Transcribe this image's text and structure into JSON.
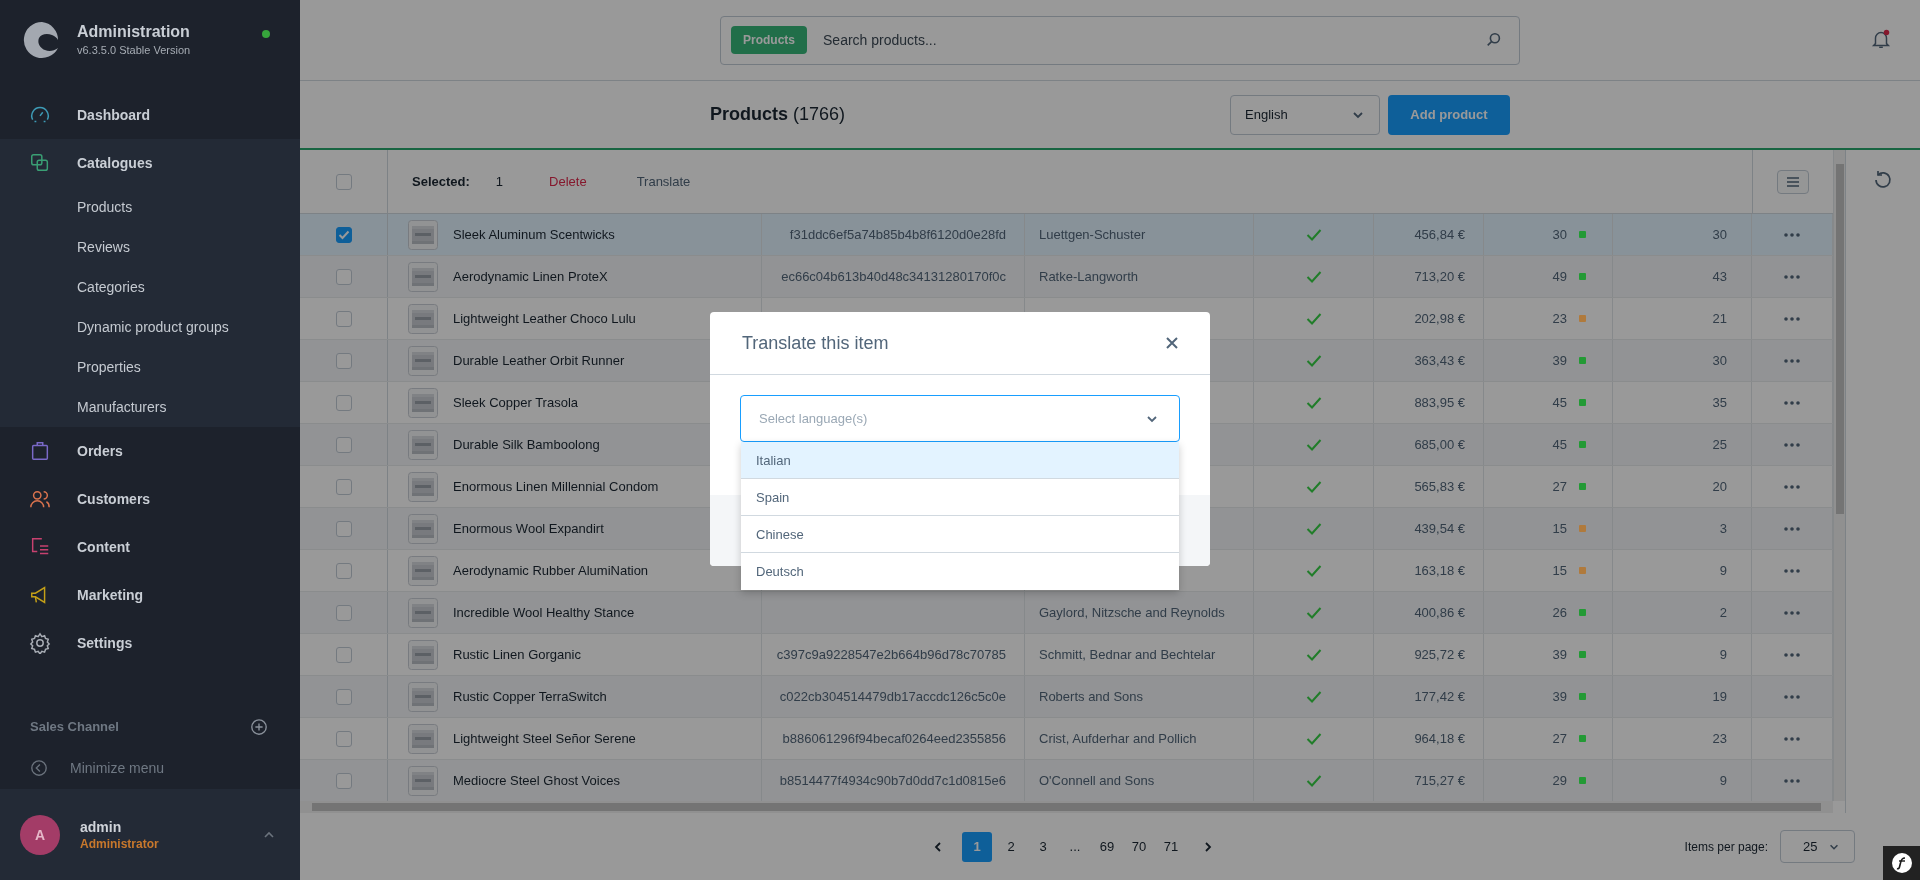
{
  "sidebar": {
    "title": "Administration",
    "version": "v6.3.5.0 Stable Version",
    "online": true,
    "items": [
      {
        "label": "Dashboard",
        "color": "#3e9bb6"
      },
      {
        "label": "Catalogues",
        "color": "#3a9f74",
        "children": [
          {
            "label": "Products"
          },
          {
            "label": "Reviews"
          },
          {
            "label": "Categories"
          },
          {
            "label": "Dynamic product groups"
          },
          {
            "label": "Properties"
          },
          {
            "label": "Manufacturers"
          }
        ]
      },
      {
        "label": "Orders",
        "color": "#7a69c8"
      },
      {
        "label": "Customers",
        "color": "#d9734e"
      },
      {
        "label": "Content",
        "color": "#c8416f"
      },
      {
        "label": "Marketing",
        "color": "#c4a017"
      },
      {
        "label": "Settings",
        "color": "#a8adb5"
      }
    ],
    "sales_channel": "Sales Channel",
    "minimize": "Minimize menu",
    "user": {
      "initial": "A",
      "name": "admin",
      "role": "Administrator"
    }
  },
  "header": {
    "search": {
      "scope": "Products",
      "placeholder": "Search products..."
    },
    "unread_notifications": true
  },
  "title_bar": {
    "title": "**Products** (1766)",
    "language": "English",
    "add_button": "Add product"
  },
  "table": {
    "bulk": {
      "all_selected": false,
      "label": "Selected:",
      "count": "1",
      "actions": [
        {
          "label": "Delete",
          "kind": "danger"
        },
        {
          "label": "Translate",
          "kind": "default"
        }
      ]
    },
    "rows": [
      {
        "selected": true,
        "name": "Sleek Aluminum Scentwicks",
        "number": "f31ddc6ef5a74b85b4b8f6120d0e28fd",
        "manufacturer": "Luettgen-Schuster",
        "active": true,
        "price": "456,84 €",
        "stock": "30",
        "color": "#239a35",
        "available": "30"
      },
      {
        "selected": false,
        "name": "Aerodynamic Linen ProteX",
        "number": "ec66c04b613b40d48c34131280170f0c",
        "manufacturer": "Ratke-Langworth",
        "active": true,
        "price": "713,20 €",
        "stock": "49",
        "color": "#239a35",
        "available": "43"
      },
      {
        "selected": false,
        "name": "Lightweight Leather Choco Lulu",
        "active": true,
        "price": "202,98 €",
        "stock": "23",
        "color": "#b07a3c",
        "available": "21"
      },
      {
        "selected": false,
        "name": "Durable Leather Orbit Runner",
        "active": true,
        "price": "363,43 €",
        "stock": "39",
        "color": "#239a35",
        "available": "30"
      },
      {
        "selected": false,
        "name": "Sleek Copper Trasola",
        "active": true,
        "price": "883,95 €",
        "stock": "45",
        "color": "#239a35",
        "available": "35"
      },
      {
        "selected": false,
        "name": "Durable Silk Bamboolong",
        "active": true,
        "price": "685,00 €",
        "stock": "45",
        "color": "#239a35",
        "available": "25"
      },
      {
        "selected": false,
        "name": "Enormous Linen Millennial Condom",
        "active": true,
        "price": "565,83 €",
        "stock": "27",
        "color": "#239a35",
        "available": "20"
      },
      {
        "selected": false,
        "name": "Enormous Wool Expandirt",
        "active": true,
        "price": "439,54 €",
        "stock": "15",
        "color": "#b07a3c",
        "available": "3"
      },
      {
        "selected": false,
        "name": "Aerodynamic Rubber AlumiNation",
        "active": true,
        "price": "163,18 €",
        "stock": "15",
        "color": "#b07a3c",
        "available": "9"
      },
      {
        "selected": false,
        "name": "Incredible Wool Healthy Stance",
        "manufacturer": "Gaylord, Nitzsche and Reynolds",
        "active": true,
        "price": "400,86 €",
        "stock": "26",
        "color": "#239a35",
        "available": "2"
      },
      {
        "selected": false,
        "name": "Rustic Linen Gorganic",
        "number": "c397c9a9228547e2b664b96d78c70785",
        "manufacturer": "Schmitt, Bednar and Bechtelar",
        "active": true,
        "price": "925,72 €",
        "stock": "39",
        "color": "#239a35",
        "available": "9"
      },
      {
        "selected": false,
        "name": "Rustic Copper TerraSwitch",
        "number": "c022cb304514479db17accdc126c5c0e",
        "manufacturer": "Roberts and Sons",
        "active": true,
        "price": "177,42 €",
        "stock": "39",
        "color": "#239a35",
        "available": "19"
      },
      {
        "selected": false,
        "name": "Lightweight Steel Señor Serene",
        "number": "b886061296f94becaf0264eed2355856",
        "manufacturer": "Crist, Aufderhar and Pollich",
        "active": true,
        "price": "964,18 €",
        "stock": "27",
        "color": "#239a35",
        "available": "23"
      },
      {
        "selected": false,
        "name": "Mediocre Steel Ghost Voices",
        "number": "b8514477f4934c90b7d0dd7c1d0815e6",
        "manufacturer": "O'Connell and Sons",
        "active": true,
        "price": "715,27 €",
        "stock": "29",
        "color": "#239a35",
        "available": "9"
      }
    ]
  },
  "pagination": {
    "pages": [
      {
        "label": "1",
        "selected": true
      },
      {
        "label": "2",
        "selected": false
      },
      {
        "label": "3",
        "selected": false
      },
      {
        "label": "...",
        "selected": false
      },
      {
        "label": "69",
        "selected": false
      },
      {
        "label": "70",
        "selected": false
      },
      {
        "label": "71",
        "selected": false
      }
    ],
    "per_page_label": "Items per page:",
    "per_page": "25"
  },
  "modal": {
    "title": "Translate this item",
    "select": {
      "placeholder": "Select language(s)",
      "options": [
        {
          "label": "Italian",
          "highlighted": true
        },
        {
          "label": "Spain",
          "highlighted": false
        },
        {
          "label": "Chinese",
          "highlighted": false
        },
        {
          "label": "Deutsch",
          "highlighted": false
        }
      ]
    }
  }
}
